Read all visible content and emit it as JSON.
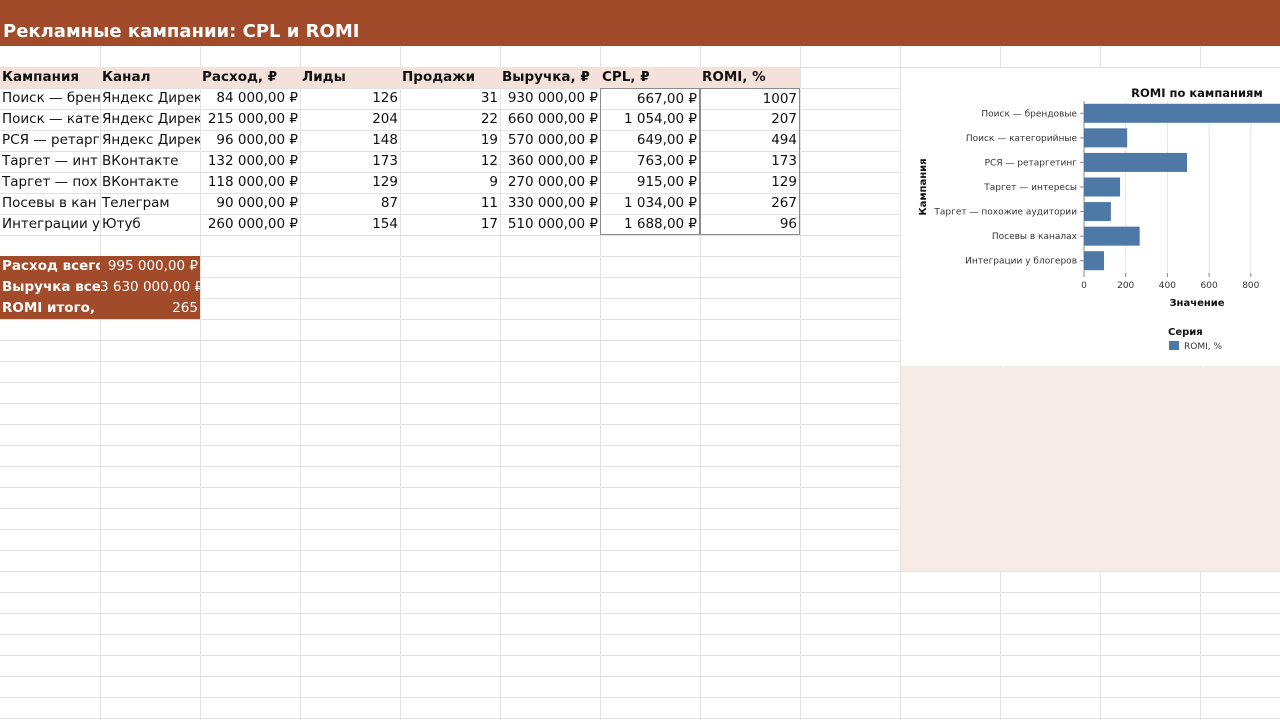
{
  "title": "Рекламные кампании: CPL и ROMI",
  "colors": {
    "accent": "#a24b2a",
    "header_fill": "#f4e1d9",
    "bar": "#4e79a7",
    "peach": "#f6ebe5"
  },
  "table": {
    "headers": [
      "Кампания",
      "Канал",
      "Расход, ₽",
      "Лиды",
      "Продажи",
      "Выручка, ₽",
      "CPL, ₽",
      "ROMI, %"
    ],
    "rows": [
      [
        "Поиск — брен",
        "Яндекс Дирек",
        "84 000,00 ₽",
        "126",
        "31",
        "930 000,00 ₽",
        "667,00 ₽",
        "1007"
      ],
      [
        "Поиск — кате",
        "Яндекс Дирек",
        "215 000,00 ₽",
        "204",
        "22",
        "660 000,00 ₽",
        "1 054,00 ₽",
        "207"
      ],
      [
        "РСЯ — ретарг",
        "Яндекс Дирек",
        "96 000,00 ₽",
        "148",
        "19",
        "570 000,00 ₽",
        "649,00 ₽",
        "494"
      ],
      [
        "Таргет — инт",
        "ВКонтакте",
        "132 000,00 ₽",
        "173",
        "12",
        "360 000,00 ₽",
        "763,00 ₽",
        "173"
      ],
      [
        "Таргет — пох",
        "ВКонтакте",
        "118 000,00 ₽",
        "129",
        "9",
        "270 000,00 ₽",
        "915,00 ₽",
        "129"
      ],
      [
        "Посевы в кан",
        "Телеграм",
        "90 000,00 ₽",
        "87",
        "11",
        "330 000,00 ₽",
        "1 034,00 ₽",
        "267"
      ],
      [
        "Интеграции у",
        "Ютуб",
        "260 000,00 ₽",
        "154",
        "17",
        "510 000,00 ₽",
        "1 688,00 ₽",
        "96"
      ]
    ]
  },
  "summary": [
    {
      "label": "Расход всего",
      "value": "995 000,00 ₽"
    },
    {
      "label": "Выручка все",
      "value": "3 630 000,00 ₽"
    },
    {
      "label": "ROMI итого,",
      "value": "265"
    }
  ],
  "chart_data": {
    "type": "bar",
    "orientation": "horizontal",
    "title": "ROMI по кампаниям",
    "ylabel": "Кампания",
    "xlabel": "Значение",
    "categories": [
      "Поиск — брендовые",
      "Поиск — категорийные",
      "РСЯ — ретаргетинг",
      "Таргет — интересы",
      "Таргет — похожие аудитории",
      "Посевы в каналах",
      "Интеграции у блогеров"
    ],
    "series": [
      {
        "name": "ROMI, %",
        "values": [
          1007,
          207,
          494,
          173,
          129,
          267,
          96
        ]
      }
    ],
    "xticks": [
      "0",
      "200",
      "400",
      "600",
      "800"
    ],
    "xlim": [
      0,
      940
    ],
    "grid": true,
    "legend_title": "Серия",
    "legend_position": "bottom"
  }
}
